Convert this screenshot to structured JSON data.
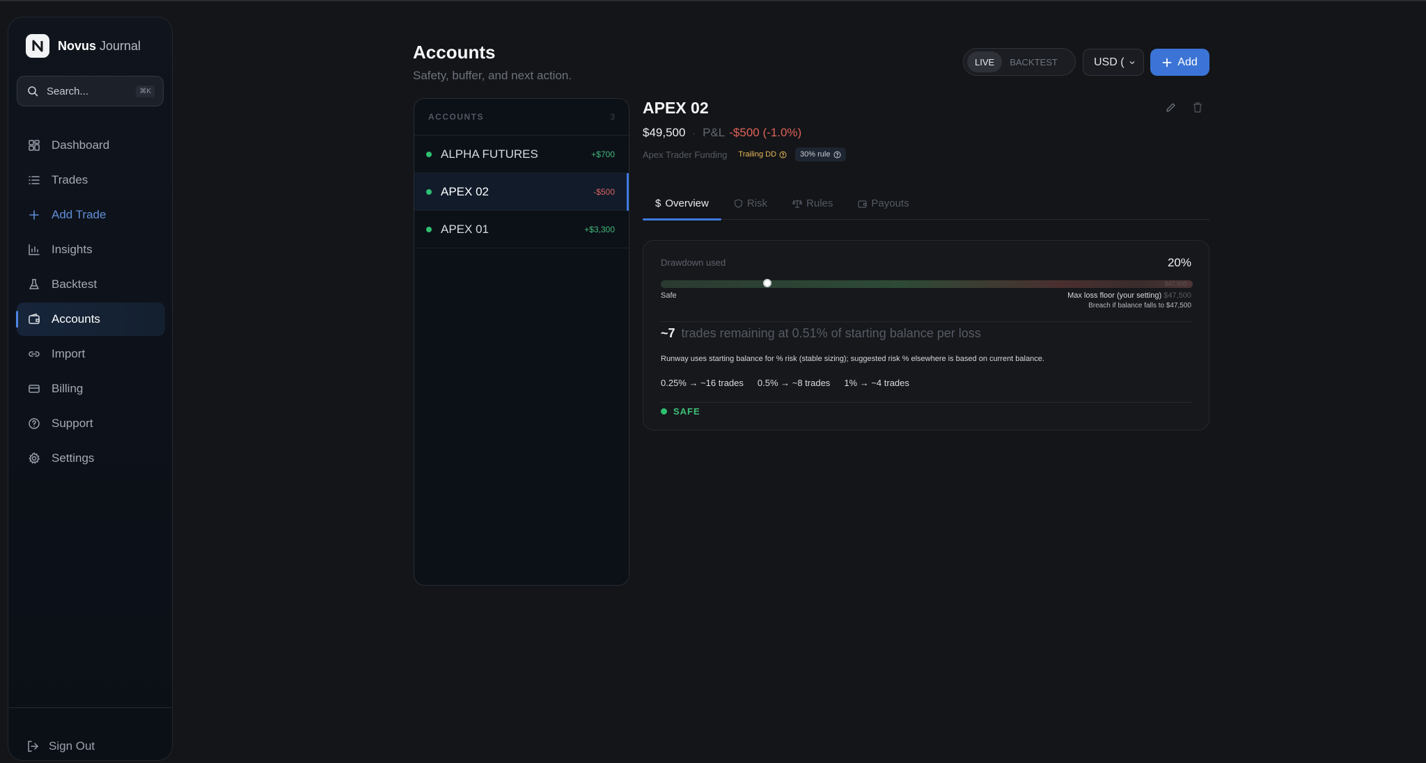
{
  "app": {
    "brand": "Novus",
    "brand_sub": "Journal"
  },
  "search": {
    "placeholder": "Search...",
    "shortcut": "⌘K"
  },
  "nav": [
    {
      "label": "Dashboard",
      "icon": "dashboard-icon"
    },
    {
      "label": "Trades",
      "icon": "list-icon"
    },
    {
      "label": "Add Trade",
      "icon": "plus-icon"
    },
    {
      "label": "Insights",
      "icon": "chart-icon"
    },
    {
      "label": "Backtest",
      "icon": "flask-icon"
    },
    {
      "label": "Accounts",
      "icon": "wallet-icon"
    },
    {
      "label": "Import",
      "icon": "link-icon"
    },
    {
      "label": "Billing",
      "icon": "card-icon"
    },
    {
      "label": "Support",
      "icon": "help-icon"
    },
    {
      "label": "Settings",
      "icon": "gear-icon"
    }
  ],
  "sign_out": "Sign Out",
  "header": {
    "title": "Accounts",
    "subtitle": "Safety, buffer, and next action.",
    "mode_live": "LIVE",
    "mode_backtest": "BACKTEST",
    "currency": "USD (",
    "add_label": "Add"
  },
  "accounts_list": {
    "heading": "ACCOUNTS",
    "count": "3",
    "items": [
      {
        "name": "ALPHA FUTURES",
        "pnl": "+$700",
        "status_color": "#2fbf71"
      },
      {
        "name": "APEX 02",
        "pnl": "-$500",
        "status_color": "#2fbf71"
      },
      {
        "name": "APEX 01",
        "pnl": "+$3,300",
        "status_color": "#2fbf71"
      }
    ]
  },
  "detail": {
    "name": "APEX 02",
    "balance": "$49,500",
    "pnl_label": "P&L",
    "pnl_value": "-$500 (-1.0%)",
    "firm": "Apex Trader Funding",
    "badge_trailing": "Trailing DD",
    "badge_rule": "30% rule",
    "tabs": [
      "Overview",
      "Risk",
      "Rules",
      "Payouts"
    ],
    "drawdown_label": "Drawdown used",
    "drawdown_pct": "20%",
    "drawdown_fraction": 0.2,
    "bar_end_label": "$47,500",
    "safe_label": "Safe",
    "floor_label": "Max loss floor (your setting)",
    "floor_amount": "$47,500",
    "breach_label": "Breach if balance falls to $47,500",
    "runway_count": "~7",
    "runway_text": "trades remaining at 0.51% of starting balance per loss",
    "runway_note": "Runway uses starting balance for % risk (stable sizing); suggested risk % elsewhere is based on current balance.",
    "scenarios": [
      "0.25% → ~16 trades",
      "0.5% → ~8 trades",
      "1% → ~4 trades"
    ],
    "status": "SAFE"
  },
  "colors": {
    "accent": "#3b74d6",
    "safe": "#2fbf71",
    "loss": "#e0625a",
    "warning": "#e6b85a"
  }
}
